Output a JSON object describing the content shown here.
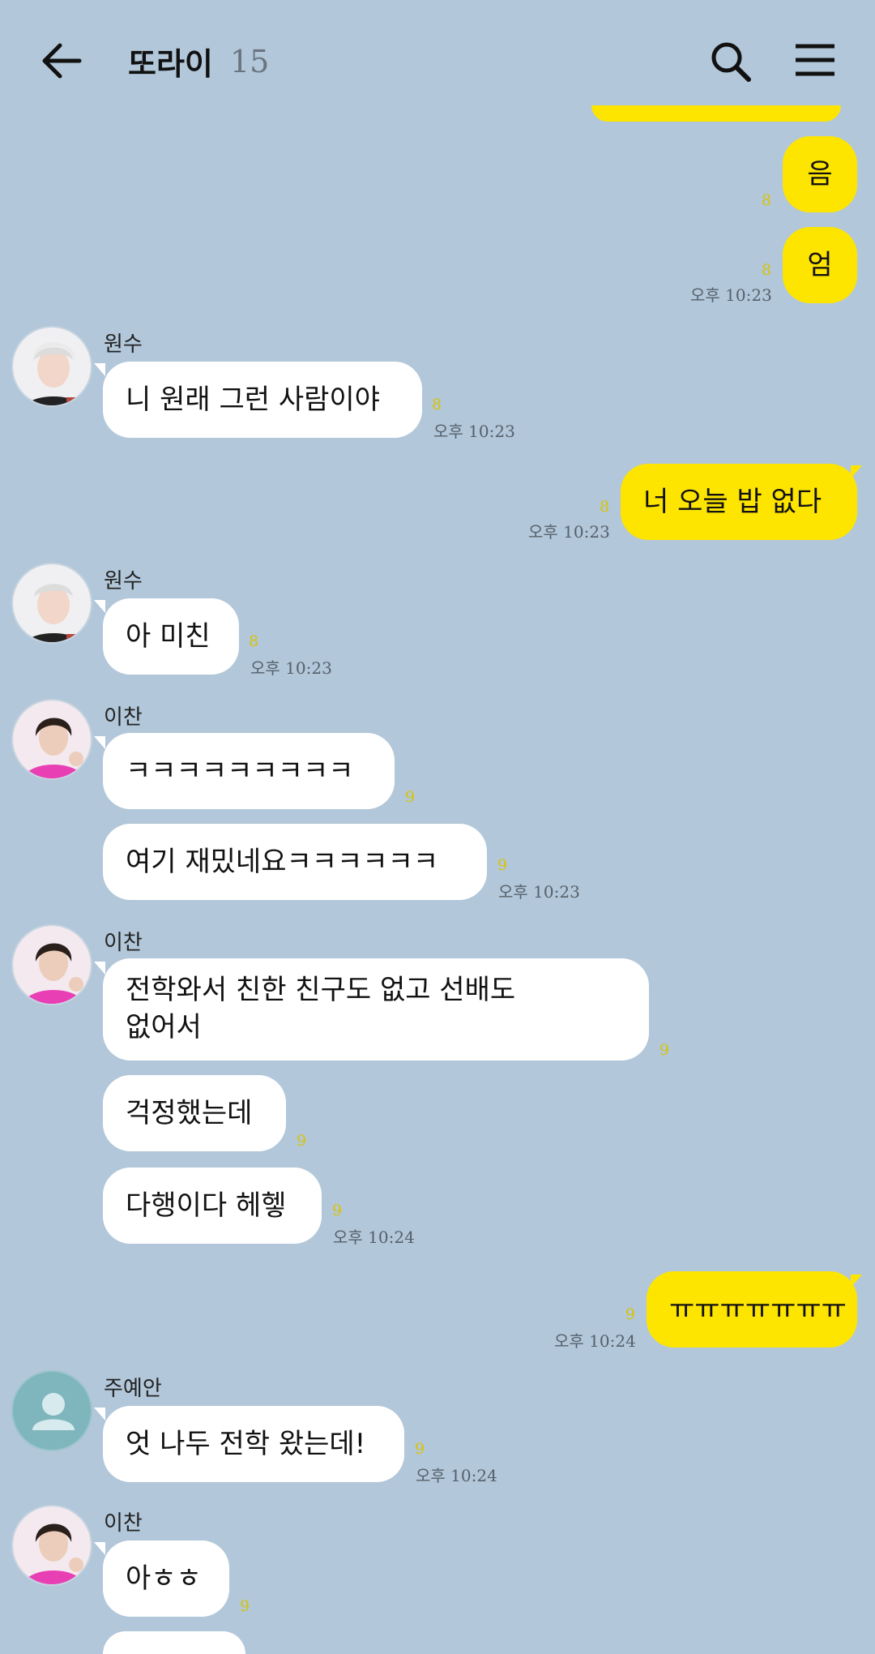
{
  "header": {
    "title": "또라이",
    "member_count": "15",
    "back_icon": "arrow-left-icon",
    "search_icon": "search-icon",
    "menu_icon": "hamburger-menu-icon"
  },
  "colors": {
    "background": "#b2c7d9",
    "my_bubble": "#fee500",
    "other_bubble": "#ffffff",
    "unread": "#d9c400"
  },
  "messages": [
    {
      "text": "음",
      "unread": "8"
    },
    {
      "text": "엄",
      "unread": "8",
      "time": "오후 10:23"
    },
    {
      "sender": "원수",
      "text": "니 원래 그런 사람이야",
      "unread": "8",
      "time": "오후 10:23"
    },
    {
      "text": "너 오늘 밥 없다",
      "unread": "8",
      "time": "오후 10:23"
    },
    {
      "sender": "원수",
      "text": "아 미친",
      "unread": "8",
      "time": "오후 10:23"
    },
    {
      "sender": "이찬",
      "text": "ㅋㅋㅋㅋㅋㅋㅋㅋㅋ",
      "unread": "9"
    },
    {
      "text": "여기 재밌네요ㅋㅋㅋㅋㅋㅋ",
      "unread": "9",
      "time": "오후 10:23"
    },
    {
      "sender": "이찬",
      "text_line1": "전학와서 친한 친구도 없고 선배도",
      "text_line2": "없어서",
      "unread": "9"
    },
    {
      "text": "걱정했는데",
      "unread": "9"
    },
    {
      "text": "다행이다 헤헿",
      "unread": "9",
      "time": "오후 10:24"
    },
    {
      "text": "ㅠㅠㅠㅠㅠㅠㅠ",
      "unread": "9",
      "time": "오후 10:24"
    },
    {
      "sender": "주예안",
      "text": "엇 나두 전학 왔는데!",
      "unread": "9",
      "time": "오후 10:24"
    },
    {
      "sender": "이찬",
      "text": "아ㅎㅎ",
      "unread": "9"
    }
  ]
}
